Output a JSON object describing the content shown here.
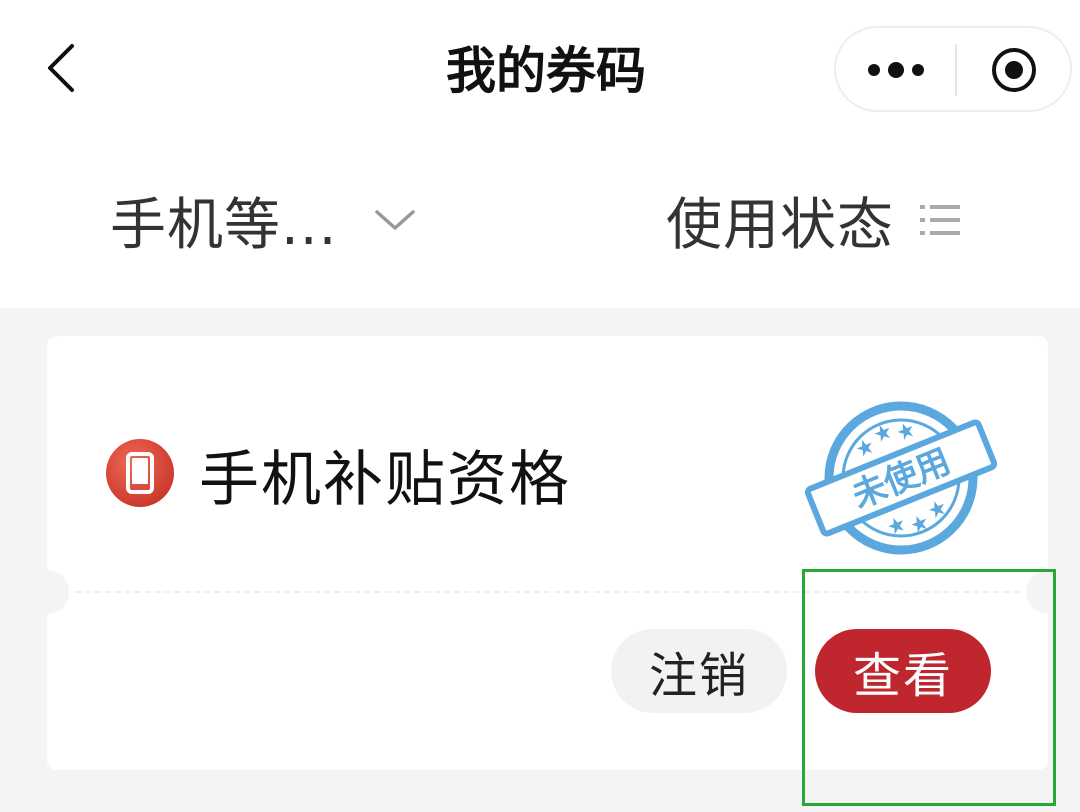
{
  "header": {
    "title": "我的券码",
    "back_icon": "chevron-left-icon",
    "more_icon": "more-dots-icon",
    "close_icon": "target-circle-icon"
  },
  "filters": {
    "category_label": "手机等...",
    "category_icon": "chevron-down-icon",
    "status_label": "使用状态",
    "status_icon": "list-icon"
  },
  "coupon": {
    "title": "手机补贴资格",
    "icon": "phone-icon",
    "stamp_text": "未使用",
    "cancel_label": "注销",
    "view_label": "查看"
  },
  "colors": {
    "accent_red": "#c0262e",
    "stamp_blue": "#5aa8dd",
    "highlight_green": "#2aa835",
    "background_gray": "#f4f4f4"
  }
}
